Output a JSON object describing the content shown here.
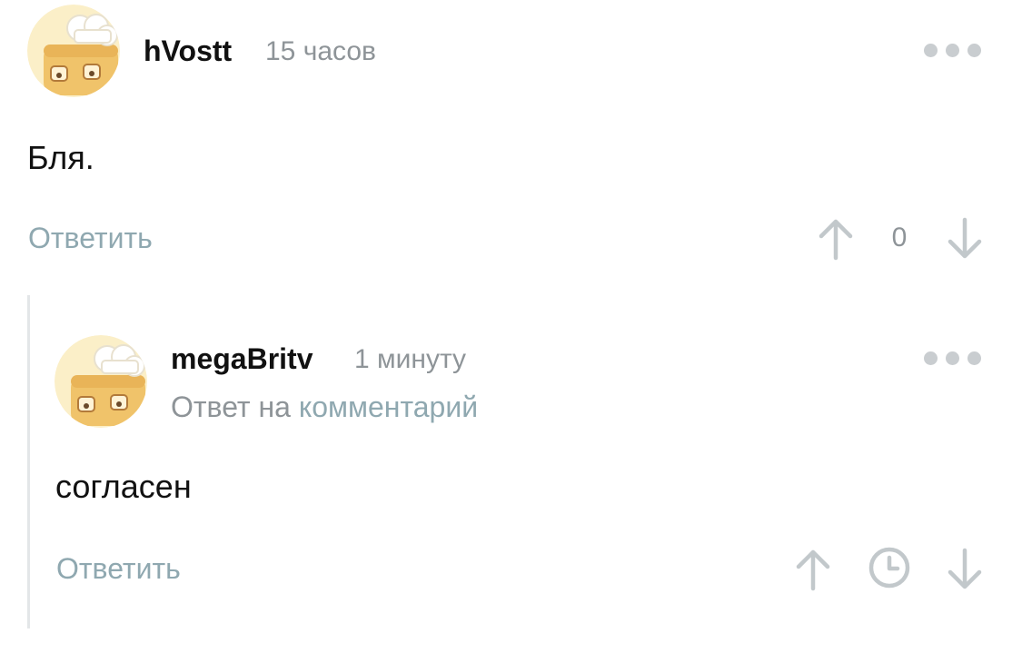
{
  "comments": [
    {
      "username": "hVostt",
      "time": "15 часов",
      "text": "Бля.",
      "reply_label": "Ответить",
      "score": "0",
      "avatar_icon": "chef-toast-avatar",
      "more_icon": "more-dots-icon",
      "upvote_icon": "arrow-up-icon",
      "downvote_icon": "arrow-down-icon"
    },
    {
      "username": "megaBritv",
      "time": "1 минуту",
      "reply_to_prefix": "Ответ на",
      "reply_to_link": "комментарий",
      "text": "согласен",
      "reply_label": "Ответить",
      "avatar_icon": "chef-toast-avatar",
      "more_icon": "more-dots-icon",
      "upvote_icon": "arrow-up-icon",
      "pending_icon": "clock-icon",
      "downvote_icon": "arrow-down-icon"
    }
  ],
  "colors": {
    "accent": "#8fa8b0",
    "muted_text": "#8e9498",
    "icon_gray": "#c9cdd0",
    "avatar_bg": "#fbefc8",
    "thread_line": "#e3e6e8"
  }
}
